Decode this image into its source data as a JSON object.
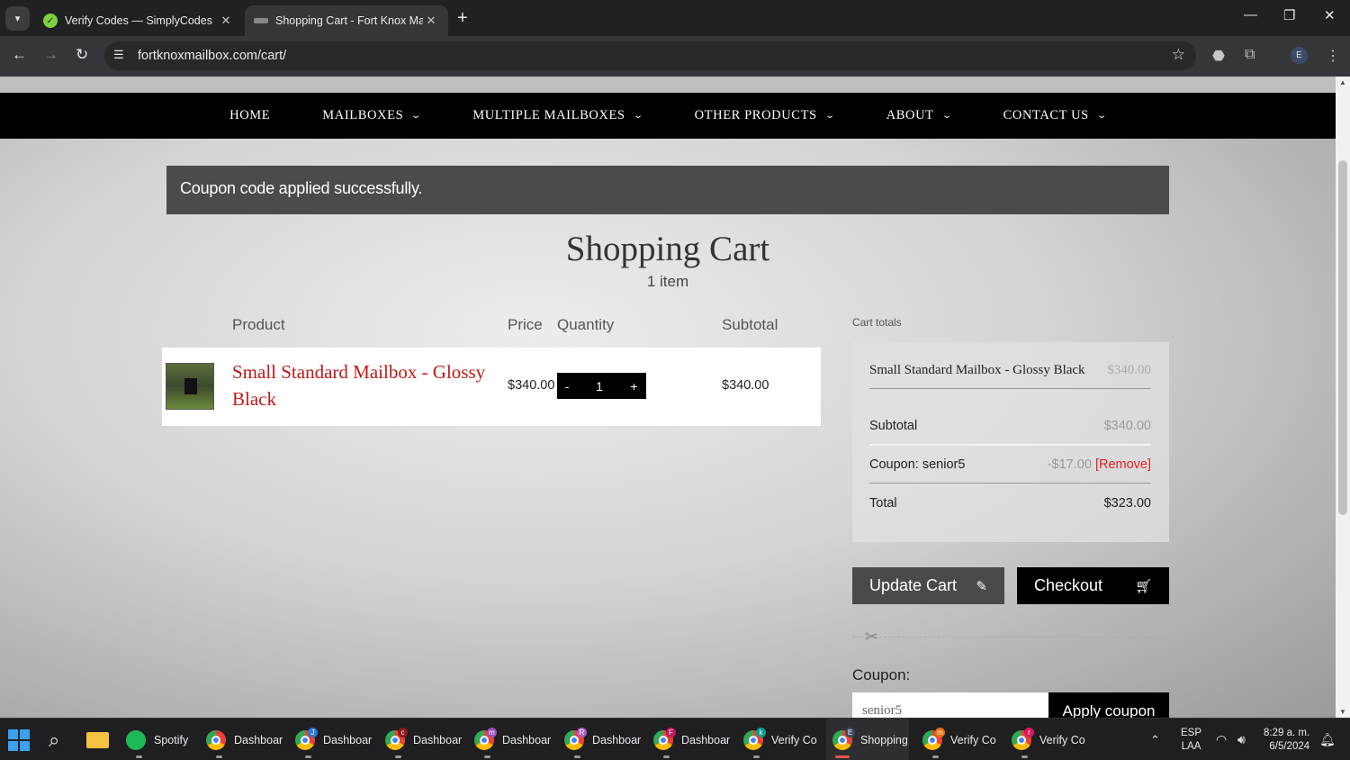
{
  "browser": {
    "tabs": [
      {
        "title": "Verify Codes — SimplyCodes",
        "active": false
      },
      {
        "title": "Shopping Cart - Fort Knox Mail",
        "active": true
      }
    ],
    "url": "fortknoxmailbox.com/cart/",
    "profile_initial": "E"
  },
  "nav": {
    "items": [
      "HOME",
      "MAILBOXES",
      "MULTIPLE MAILBOXES",
      "OTHER PRODUCTS",
      "ABOUT",
      "CONTACT US"
    ]
  },
  "notice": "Coupon code applied successfully.",
  "cart": {
    "title": "Shopping Cart",
    "count": "1 item",
    "headers": {
      "product": "Product",
      "price": "Price",
      "quantity": "Quantity",
      "subtotal": "Subtotal"
    },
    "row": {
      "name": "Small Standard Mailbox - Glossy Black",
      "price": "$340.00",
      "qty_minus": "-",
      "qty": "1",
      "qty_plus": "+",
      "subtotal": "$340.00"
    }
  },
  "totals": {
    "label": "Cart totals",
    "product_name": "Small Standard Mailbox - Glossy Black",
    "product_price": "$340.00",
    "subtotal_label": "Subtotal",
    "subtotal": "$340.00",
    "coupon_label": "Coupon: senior5",
    "coupon_amount": "-$17.00",
    "remove_label": "[Remove]",
    "total_label": "Total",
    "total": "$323.00"
  },
  "actions": {
    "update": "Update Cart",
    "checkout": "Checkout"
  },
  "coupon": {
    "label": "Coupon:",
    "value": "senior5",
    "apply": "Apply coupon"
  },
  "taskbar": {
    "apps": [
      {
        "label": "Spotify"
      },
      {
        "label": "Dashboar"
      },
      {
        "label": "Dashboar"
      },
      {
        "label": "Dashboar"
      },
      {
        "label": "Dashboar"
      },
      {
        "label": "Dashboar"
      },
      {
        "label": "Dashboar"
      },
      {
        "label": "Verify Co"
      },
      {
        "label": "Shopping"
      },
      {
        "label": "Verify Co"
      },
      {
        "label": "Verify Co"
      }
    ],
    "badges": [
      "",
      "",
      "J",
      "c",
      "m",
      "R",
      "F",
      "k",
      "E",
      "m",
      "r"
    ],
    "lang": "ESP",
    "lang2": "LAA",
    "time": "8:29 a. m.",
    "date": "6/5/2024"
  },
  "colors": {
    "accent_red": "#c21818",
    "notice_bg": "#4b4b4b"
  }
}
